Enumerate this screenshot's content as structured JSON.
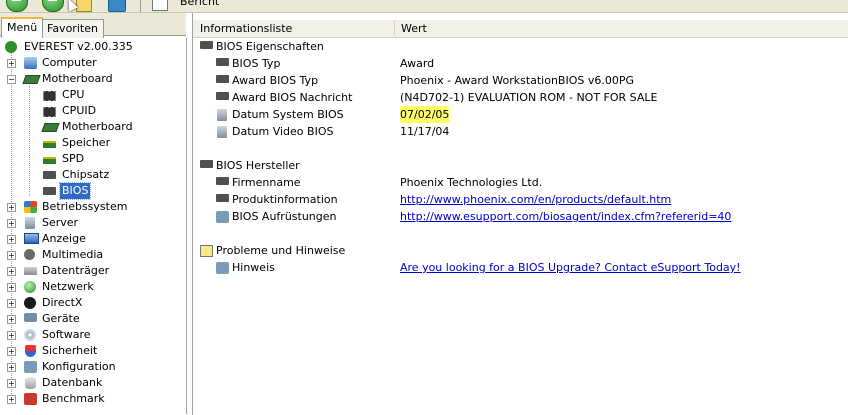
{
  "toolbar": {
    "report_label": "Bericht"
  },
  "tabs": {
    "menu": "Menü",
    "favorites": "Favoriten"
  },
  "tree": {
    "root": "EVEREST v2.00.335",
    "computer": "Computer",
    "motherboard": "Motherboard",
    "children": [
      "CPU",
      "CPUID",
      "Motherboard",
      "Speicher",
      "SPD",
      "Chipsatz",
      "BIOS"
    ],
    "selected": "BIOS",
    "others": [
      "Betriebssystem",
      "Server",
      "Anzeige",
      "Multimedia",
      "Datenträger",
      "Netzwerk",
      "DirectX",
      "Geräte",
      "Software",
      "Sicherheit",
      "Konfiguration",
      "Datenbank",
      "Benchmark"
    ]
  },
  "list": {
    "col_info": "Informationsliste",
    "col_value": "Wert",
    "groups": [
      {
        "title": "BIOS Eigenschaften",
        "items": [
          {
            "label": "BIOS Typ",
            "value": "Award"
          },
          {
            "label": "Award BIOS Typ",
            "value": "Phoenix - Award WorkstationBIOS v6.00PG"
          },
          {
            "label": "Award BIOS Nachricht",
            "value": "(N4D702-1) EVALUATION ROM - NOT FOR SALE"
          },
          {
            "label": "Datum System BIOS",
            "value": "07/02/05"
          },
          {
            "label": "Datum Video BIOS",
            "value": "11/17/04"
          }
        ]
      },
      {
        "title": "BIOS Hersteller",
        "items": [
          {
            "label": "Firmenname",
            "value": "Phoenix Technologies Ltd."
          },
          {
            "label": "Produktinformation",
            "value": "http://www.phoenix.com/en/products/default.htm"
          },
          {
            "label": "BIOS Aufrüstungen",
            "value": "http://www.esupport.com/biosagent/index.cfm?refererid=40"
          }
        ]
      },
      {
        "title": "Probleme und Hinweise",
        "items": [
          {
            "label": "Hinweis",
            "value": "Are you looking for a BIOS Upgrade?  Contact eSupport Today!"
          }
        ]
      }
    ]
  },
  "colors": {
    "highlight": "#ffff66",
    "link": "#0000cc",
    "selection": "#316ac5"
  }
}
